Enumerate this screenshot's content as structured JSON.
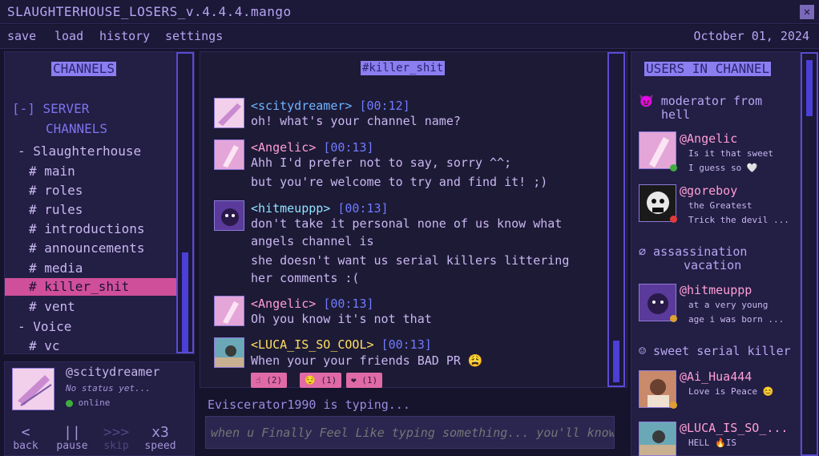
{
  "window": {
    "title": "SLAUGHTERHOUSE_LOSERS_v.4.4.4.mango",
    "close_glyph": "✕"
  },
  "menu": {
    "items": [
      "save",
      "load",
      "history",
      "settings"
    ],
    "date": "October 01, 2024"
  },
  "channels": {
    "heading": "CHANNELS",
    "server_line1": "[-] SERVER",
    "server_line2": "CHANNELS",
    "items": [
      {
        "label": "- Slaughterhouse",
        "type": "category"
      },
      {
        "label": "# main",
        "type": "channel"
      },
      {
        "label": "# roles",
        "type": "channel"
      },
      {
        "label": "# rules",
        "type": "channel"
      },
      {
        "label": "# introductions",
        "type": "channel"
      },
      {
        "label": "# announcements",
        "type": "channel"
      },
      {
        "label": "# media",
        "type": "channel"
      },
      {
        "label": "# killer_shit",
        "type": "channel",
        "selected": true
      },
      {
        "label": "# vent",
        "type": "channel"
      },
      {
        "label": "- Voice",
        "type": "category"
      },
      {
        "label": "# vc",
        "type": "channel"
      }
    ]
  },
  "me": {
    "name": "@scitydreamer",
    "status": "No status yet...",
    "online": "online",
    "online_color": "#3fae3f"
  },
  "controls": [
    {
      "symbol": "<",
      "label": "back",
      "enabled": true
    },
    {
      "symbol": "||",
      "label": "pause",
      "enabled": true
    },
    {
      "symbol": ">>>",
      "label": "skip",
      "enabled": false
    },
    {
      "symbol": "x3",
      "label": "speed",
      "enabled": true
    }
  ],
  "chat": {
    "channel_title": "#killer_shit",
    "messages": [
      {
        "user": "<scitydreamer>",
        "time": "[00:12]",
        "lines": [
          "oh! what's your channel name?"
        ]
      },
      {
        "user": "<Angelic>",
        "time": "[00:13]",
        "lines": [
          "Ahh I'd prefer not to say, sorry ^^;",
          "but you're welcome to try and find it! ;)"
        ]
      },
      {
        "user": "<hitmeuppp>",
        "time": "[00:13]",
        "lines": [
          "don't take it personal none of us know what",
          "angels channel is",
          "she doesn't want us serial killers littering",
          "her comments :("
        ]
      },
      {
        "user": "<Angelic>",
        "time": "[00:13]",
        "lines": [
          "Oh you know it's not that"
        ]
      },
      {
        "user": "<LUCA_IS_SO_COOL>",
        "time": "[00:13]",
        "lines": [
          "When your your friends BAD PR 😩"
        ]
      }
    ],
    "reactions": [
      {
        "emoji": "☝",
        "count": "(2)"
      },
      {
        "emoji": "😌",
        "count": "(1)"
      },
      {
        "emoji": "❤",
        "count": "(1)"
      }
    ],
    "typing": "Eviscerator1990 is typing...",
    "input_placeholder": "when u Finally Feel Like typing something... you'll know"
  },
  "users": {
    "heading": "USERS IN CHANNEL",
    "groups": [
      {
        "role_line1": "😈 moderator from",
        "role_line2": "hell"
      },
      {
        "role_line1": "∅ assassination",
        "role_line2": "vacation"
      },
      {
        "role_line1": "☺ sweet serial killer",
        "role_line2": ""
      }
    ],
    "list": [
      {
        "name": "@Angelic",
        "status1": "Is it that sweet",
        "status2": "I guess so 🤍",
        "dot": "#3fae3f"
      },
      {
        "name": "@goreboy",
        "status1": "the Greatest",
        "status2": "Trick the devil ...",
        "dot": "#e03a3a"
      },
      {
        "name": "@hitmeuppp",
        "status1": "at a very young",
        "status2": "age i was born ...",
        "dot": "#e0a030"
      },
      {
        "name": "@Ai_Hua444",
        "status1": "Love is Peace 😊",
        "status2": "",
        "dot": "#e0a030"
      },
      {
        "name": "@LUCA_IS_SO_...",
        "status1": "HELL 🔥IS",
        "status2": "",
        "dot": "#e0a030"
      }
    ]
  }
}
